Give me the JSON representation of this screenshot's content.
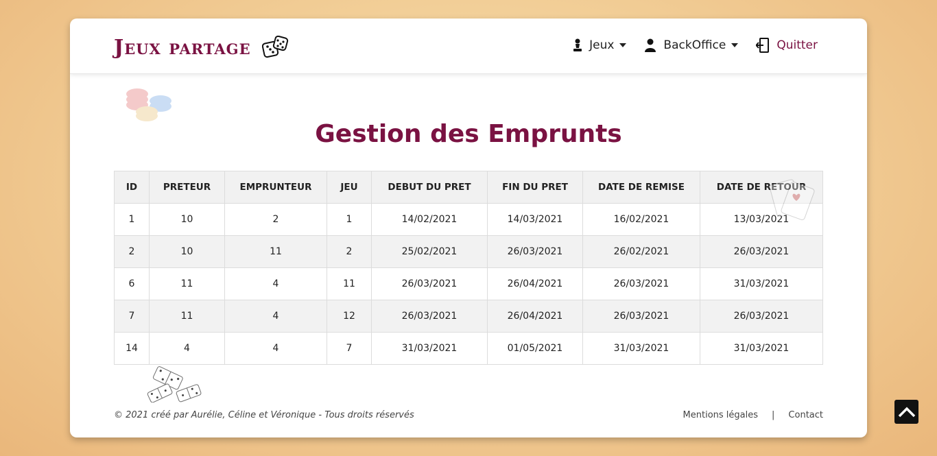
{
  "brand": {
    "title": "Jeux partage"
  },
  "nav": [
    {
      "label": "Jeux",
      "icon": "pawn-icon"
    },
    {
      "label": "BackOffice",
      "icon": "user-icon"
    },
    {
      "label": "Quitter",
      "icon": "logout-icon"
    }
  ],
  "page": {
    "title": "Gestion des Emprunts"
  },
  "table": {
    "headers": [
      "ID",
      "PRETEUR",
      "EMPRUNTEUR",
      "JEU",
      "DEBUT DU PRET",
      "FIN DU PRET",
      "DATE DE REMISE",
      "DATE DE RETOUR"
    ],
    "rows": [
      [
        "1",
        "10",
        "2",
        "1",
        "14/02/2021",
        "14/03/2021",
        "16/02/2021",
        "13/03/2021"
      ],
      [
        "2",
        "10",
        "11",
        "2",
        "25/02/2021",
        "26/03/2021",
        "26/02/2021",
        "26/03/2021"
      ],
      [
        "6",
        "11",
        "4",
        "11",
        "26/03/2021",
        "26/04/2021",
        "26/03/2021",
        "31/03/2021"
      ],
      [
        "7",
        "11",
        "4",
        "12",
        "26/03/2021",
        "26/04/2021",
        "26/03/2021",
        "26/03/2021"
      ],
      [
        "14",
        "4",
        "4",
        "7",
        "31/03/2021",
        "01/05/2021",
        "31/03/2021",
        "31/03/2021"
      ]
    ]
  },
  "footer": {
    "copyright": "© 2021 créé par Aurélie, Céline et Véronique - Tous droits réservés",
    "legal": "Mentions légales",
    "separator": "|",
    "contact": "Contact"
  },
  "colors": {
    "brand": "#7a1242",
    "background": "#f2cf98"
  }
}
